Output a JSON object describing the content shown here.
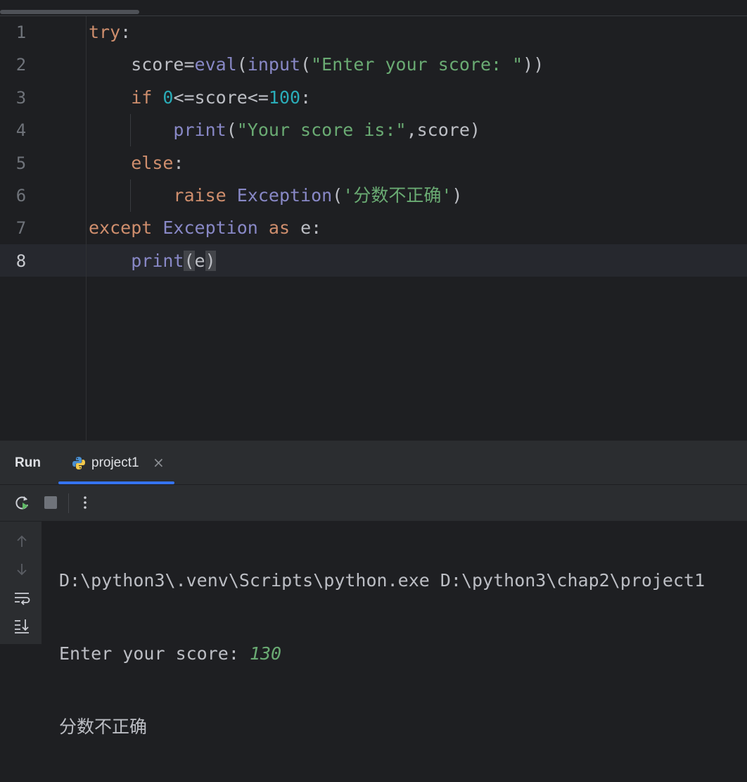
{
  "editor": {
    "line_numbers": [
      "1",
      "2",
      "3",
      "4",
      "5",
      "6",
      "7",
      "8"
    ],
    "lines": [
      {
        "tokens": [
          {
            "t": "try",
            "c": "kw"
          },
          {
            "t": ":",
            "c": ""
          }
        ]
      },
      {
        "tokens": [
          {
            "t": "    score=",
            "c": ""
          },
          {
            "t": "eval",
            "c": "fn"
          },
          {
            "t": "(",
            "c": ""
          },
          {
            "t": "input",
            "c": "fn"
          },
          {
            "t": "(",
            "c": ""
          },
          {
            "t": "\"Enter your score: \"",
            "c": "str"
          },
          {
            "t": "))",
            "c": ""
          }
        ]
      },
      {
        "tokens": [
          {
            "t": "    ",
            "c": ""
          },
          {
            "t": "if",
            "c": "kw"
          },
          {
            "t": " ",
            "c": ""
          },
          {
            "t": "0",
            "c": "num"
          },
          {
            "t": "<=score<=",
            "c": ""
          },
          {
            "t": "100",
            "c": "num"
          },
          {
            "t": ":",
            "c": ""
          }
        ]
      },
      {
        "tokens": [
          {
            "t": "        ",
            "c": ""
          },
          {
            "t": "print",
            "c": "fn"
          },
          {
            "t": "(",
            "c": ""
          },
          {
            "t": "\"Your score is:\"",
            "c": "str"
          },
          {
            "t": ",score)",
            "c": ""
          }
        ]
      },
      {
        "tokens": [
          {
            "t": "    ",
            "c": ""
          },
          {
            "t": "else",
            "c": "kw"
          },
          {
            "t": ":",
            "c": ""
          }
        ]
      },
      {
        "tokens": [
          {
            "t": "        ",
            "c": ""
          },
          {
            "t": "raise",
            "c": "kw"
          },
          {
            "t": " ",
            "c": ""
          },
          {
            "t": "Exception",
            "c": "cls"
          },
          {
            "t": "(",
            "c": ""
          },
          {
            "t": "'分数不正确'",
            "c": "str"
          },
          {
            "t": ")",
            "c": ""
          }
        ]
      },
      {
        "tokens": [
          {
            "t": "except",
            "c": "kw"
          },
          {
            "t": " ",
            "c": ""
          },
          {
            "t": "Exception",
            "c": "cls"
          },
          {
            "t": " ",
            "c": ""
          },
          {
            "t": "as",
            "c": "kw"
          },
          {
            "t": " e:",
            "c": ""
          }
        ]
      },
      {
        "tokens": [
          {
            "t": "    ",
            "c": ""
          },
          {
            "t": "print",
            "c": "fn"
          },
          {
            "t": "(",
            "c": "brace-hl"
          },
          {
            "t": "e",
            "c": ""
          },
          {
            "t": ")",
            "c": "brace-hl"
          }
        ]
      }
    ],
    "active_line": "8"
  },
  "run_panel": {
    "title": "Run",
    "tab_label": "project1",
    "close_glyph": "×",
    "console": {
      "line1": "D:\\python3\\.venv\\Scripts\\python.exe D:\\python3\\chap2\\project1",
      "prompt": "Enter your score: ",
      "input_value": "130",
      "line3": "分数不正确"
    }
  },
  "colors": {
    "background": "#1e1f22",
    "panel": "#2b2d30",
    "keyword": "#cf8e6d",
    "function": "#8888c6",
    "number": "#2aacb8",
    "string": "#6aab73",
    "accent": "#3574f0"
  },
  "icons": {
    "rerun": "rerun-icon",
    "stop": "stop-icon",
    "more": "more-options-icon",
    "up": "arrow-up-icon",
    "down": "arrow-down-icon",
    "wrap": "soft-wrap-icon",
    "scroll_end": "scroll-to-end-icon",
    "python": "python-icon"
  }
}
